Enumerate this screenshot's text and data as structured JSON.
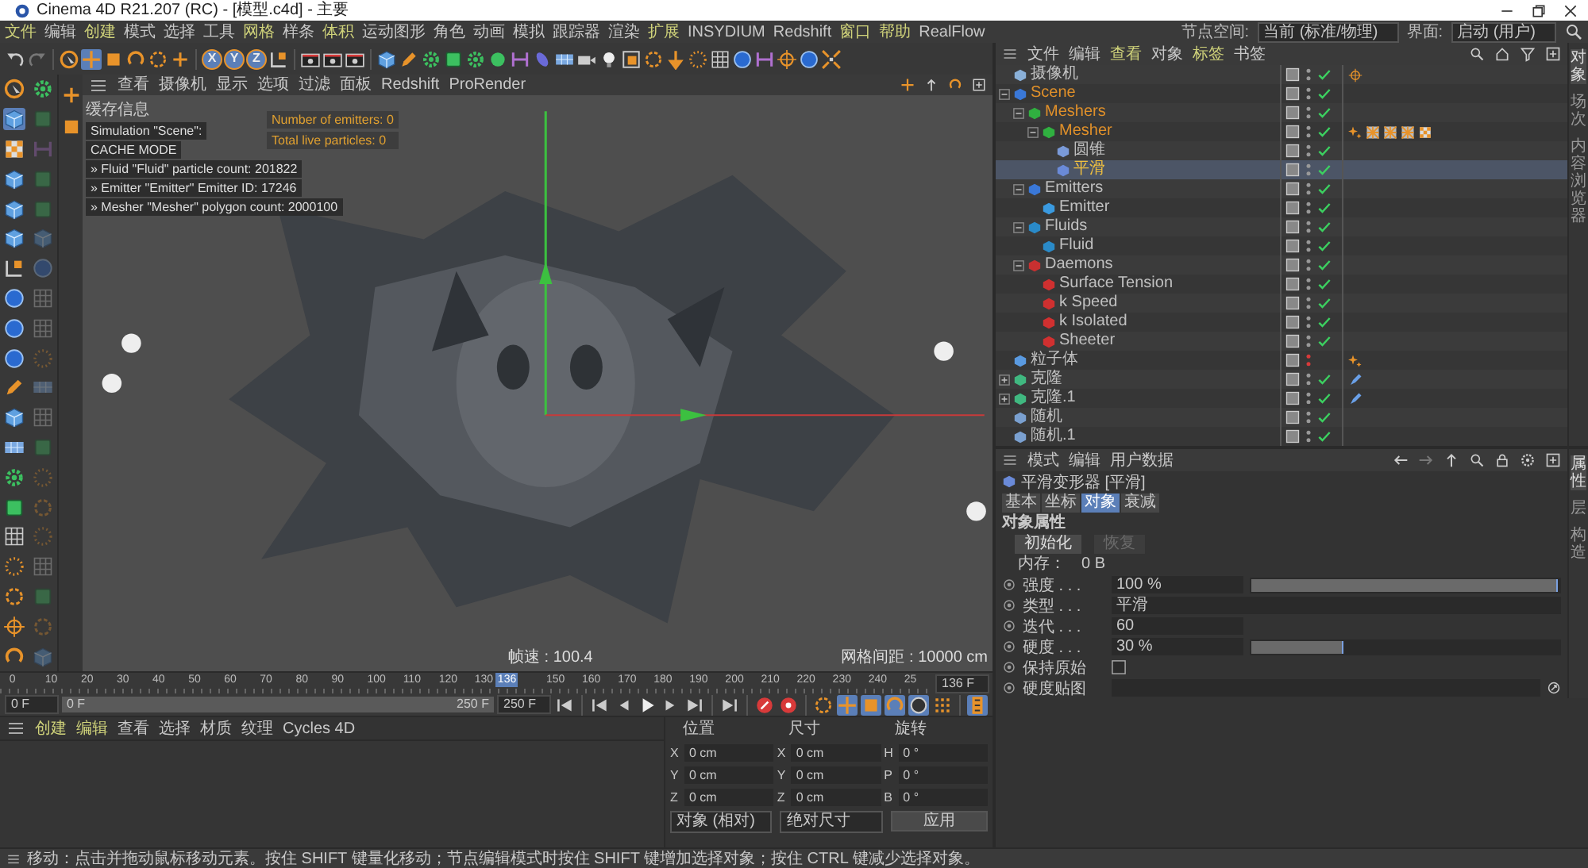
{
  "window": {
    "title": "Cinema 4D R21.207 (RC) - [模型.c4d] - 主要"
  },
  "menu": [
    {
      "label": "文件",
      "highlighted": true
    },
    {
      "label": "编辑",
      "highlighted": false
    },
    {
      "label": "创建",
      "highlighted": true
    },
    {
      "label": "模式",
      "highlighted": false
    },
    {
      "label": "选择",
      "highlighted": false
    },
    {
      "label": "工具",
      "highlighted": false
    },
    {
      "label": "网格",
      "highlighted": true
    },
    {
      "label": "样条",
      "highlighted": false
    },
    {
      "label": "体积",
      "highlighted": true
    },
    {
      "label": "运动图形",
      "highlighted": false
    },
    {
      "label": "角色",
      "highlighted": false
    },
    {
      "label": "动画",
      "highlighted": false
    },
    {
      "label": "模拟",
      "highlighted": false
    },
    {
      "label": "跟踪器",
      "highlighted": false
    },
    {
      "label": "渲染",
      "highlighted": false
    },
    {
      "label": "扩展",
      "highlighted": true
    },
    {
      "label": "INSYDIUM",
      "highlighted": false
    },
    {
      "label": "Redshift",
      "highlighted": false
    },
    {
      "label": "窗口",
      "highlighted": true
    },
    {
      "label": "帮助",
      "highlighted": true
    },
    {
      "label": "RealFlow",
      "highlighted": false
    }
  ],
  "node_space": {
    "label": "节点空间:",
    "value": "当前 (标准/物理)"
  },
  "layout": {
    "label": "界面:",
    "value": "启动 (用户)"
  },
  "toolbar": [
    {
      "kind": "undo",
      "selected": false
    },
    {
      "kind": "redo",
      "selected": false
    },
    {
      "kind": "sep"
    },
    {
      "kind": "select",
      "selected": false
    },
    {
      "kind": "move",
      "selected": true
    },
    {
      "kind": "scale",
      "selected": false
    },
    {
      "kind": "rotate",
      "selected": false
    },
    {
      "kind": "ring",
      "selected": false
    },
    {
      "kind": "plus",
      "selected": false
    },
    {
      "kind": "sep"
    },
    {
      "kind": "axis",
      "label": "X",
      "selected": true
    },
    {
      "kind": "axis",
      "label": "Y",
      "selected": true
    },
    {
      "kind": "axis",
      "label": "Z",
      "selected": true
    },
    {
      "kind": "axes",
      "selected": false
    },
    {
      "kind": "sep"
    },
    {
      "kind": "clap",
      "selected": false
    },
    {
      "kind": "clap",
      "selected": false
    },
    {
      "kind": "clap",
      "selected": false
    },
    {
      "kind": "sep"
    },
    {
      "kind": "cube",
      "selected": false
    },
    {
      "kind": "pen",
      "selected": false
    },
    {
      "kind": "gear",
      "selected": false
    },
    {
      "kind": "box",
      "selected": false
    },
    {
      "kind": "gear",
      "selected": false
    },
    {
      "kind": "sphere",
      "selected": false
    },
    {
      "kind": "bars",
      "selected": false
    },
    {
      "kind": "blob",
      "selected": false
    },
    {
      "kind": "plane",
      "selected": false
    },
    {
      "kind": "camera",
      "selected": false
    },
    {
      "kind": "bulb",
      "selected": false
    },
    {
      "kind": "frame",
      "selected": false
    },
    {
      "kind": "ring",
      "selected": false
    },
    {
      "kind": "arrow",
      "selected": false
    },
    {
      "kind": "dots",
      "selected": false
    },
    {
      "kind": "grid",
      "selected": false
    },
    {
      "kind": "coin",
      "selected": false
    },
    {
      "kind": "bars",
      "selected": false
    },
    {
      "kind": "target",
      "selected": false
    },
    {
      "kind": "coin",
      "selected": false
    },
    {
      "kind": "shrink",
      "selected": false
    }
  ],
  "palette": [
    {
      "kind": "select",
      "selected": false,
      "disabled": false
    },
    {
      "kind": "cube",
      "selected": true,
      "disabled": false
    },
    {
      "kind": "checker",
      "selected": false,
      "disabled": false
    },
    {
      "kind": "cube",
      "selected": false,
      "disabled": false
    },
    {
      "kind": "cube",
      "selected": false,
      "disabled": false
    },
    {
      "kind": "cube",
      "selected": false,
      "disabled": false
    },
    {
      "kind": "axes",
      "selected": false,
      "disabled": false
    },
    {
      "kind": "coin",
      "selected": false,
      "disabled": false
    },
    {
      "kind": "coin",
      "selected": false,
      "disabled": false
    },
    {
      "kind": "coin",
      "selected": false,
      "disabled": false
    },
    {
      "kind": "pen",
      "selected": false,
      "disabled": false
    },
    {
      "kind": "cube",
      "selected": false,
      "disabled": false
    },
    {
      "kind": "plane",
      "selected": false,
      "disabled": false
    },
    {
      "kind": "gear",
      "selected": false,
      "disabled": false
    },
    {
      "kind": "box",
      "selected": false,
      "disabled": false
    },
    {
      "kind": "grid",
      "selected": false,
      "disabled": false
    },
    {
      "kind": "dots",
      "selected": false,
      "disabled": false
    },
    {
      "kind": "ring",
      "selected": false,
      "disabled": false
    },
    {
      "kind": "target",
      "selected": false,
      "disabled": false
    },
    {
      "kind": "rotate",
      "selected": false,
      "disabled": false
    },
    {
      "kind": "gear",
      "selected": false,
      "disabled": false
    },
    {
      "kind": "box",
      "selected": false,
      "disabled": true
    },
    {
      "kind": "bars",
      "selected": false,
      "disabled": true
    },
    {
      "kind": "box",
      "selected": false,
      "disabled": true
    },
    {
      "kind": "box",
      "selected": false,
      "disabled": true
    },
    {
      "kind": "cube",
      "selected": false,
      "disabled": true
    },
    {
      "kind": "coin",
      "selected": false,
      "disabled": true
    },
    {
      "kind": "grid",
      "selected": false,
      "disabled": true
    },
    {
      "kind": "grid",
      "selected": false,
      "disabled": true
    },
    {
      "kind": "dots",
      "selected": false,
      "disabled": true
    },
    {
      "kind": "plane",
      "selected": false,
      "disabled": true
    },
    {
      "kind": "grid",
      "selected": false,
      "disabled": true
    },
    {
      "kind": "box",
      "selected": false,
      "disabled": true
    },
    {
      "kind": "dots",
      "selected": false,
      "disabled": true
    },
    {
      "kind": "ring",
      "selected": false,
      "disabled": true
    },
    {
      "kind": "dots",
      "selected": false,
      "disabled": true
    },
    {
      "kind": "grid",
      "selected": false,
      "disabled": true
    },
    {
      "kind": "box",
      "selected": false,
      "disabled": true
    },
    {
      "kind": "ring",
      "selected": false,
      "disabled": true
    },
    {
      "kind": "cube",
      "selected": false,
      "disabled": true
    }
  ],
  "viewport": {
    "menu": [
      "查看",
      "摄像机",
      "显示",
      "选项",
      "过滤",
      "面板",
      "Redshift",
      "ProRender"
    ],
    "info": {
      "title": "缓存信息",
      "lines": [
        "Simulation \"Scene\":",
        "CACHE MODE",
        "» Fluid \"Fluid\" particle count: 201822",
        "» Emitter \"Emitter\" Emitter ID: 17246",
        "» Mesher \"Mesher\" polygon count: 2000100"
      ]
    },
    "stats": [
      "Number of emitters: 0",
      "Total live particles: 0"
    ],
    "fps": "帧速 : 100.4",
    "grid": "网格间距 : 10000 cm"
  },
  "object_manager": {
    "menu": [
      {
        "label": "文件",
        "highlighted": false
      },
      {
        "label": "编辑",
        "highlighted": false
      },
      {
        "label": "查看",
        "highlighted": true
      },
      {
        "label": "对象",
        "highlighted": false
      },
      {
        "label": "标签",
        "highlighted": true
      },
      {
        "label": "书签",
        "highlighted": false
      }
    ],
    "side_tabs": [
      {
        "label": "对象",
        "selected": true
      },
      {
        "label": "场次",
        "selected": false
      },
      {
        "label": "内容浏览器",
        "selected": false
      }
    ],
    "objects": [
      {
        "name": "摄像机",
        "color": "#8ab0d8",
        "selected": false,
        "highlighted": false,
        "enabled": true,
        "tags": [
          {
            "kind": "target"
          }
        ]
      },
      {
        "name": "Scene",
        "color": "#3a78d8",
        "selected": false,
        "highlighted": true,
        "enabled": true,
        "expanded": true,
        "children": [
          {
            "name": "Meshers",
            "color": "#30b040",
            "selected": false,
            "highlighted": true,
            "enabled": true,
            "expanded": true,
            "children": [
              {
                "name": "Mesher",
                "color": "#30b040",
                "selected": false,
                "highlighted": true,
                "enabled": true,
                "expanded": true,
                "tags": [
                  {
                    "kind": "star"
                  },
                  {
                    "kind": "texture"
                  },
                  {
                    "kind": "texture"
                  },
                  {
                    "kind": "texture"
                  },
                  {
                    "kind": "checker"
                  }
                ],
                "children": [
                  {
                    "name": "圆锥",
                    "color": "#7a9ad8",
                    "selected": false,
                    "highlighted": false,
                    "enabled": true
                  },
                  {
                    "name": "平滑",
                    "color": "#6a8ad8",
                    "selected": true,
                    "highlighted": false,
                    "enabled": true
                  }
                ]
              }
            ]
          },
          {
            "name": "Emitters",
            "color": "#3a78d8",
            "selected": false,
            "highlighted": false,
            "enabled": true,
            "expanded": true,
            "children": [
              {
                "name": "Emitter",
                "color": "#3a9ae0",
                "selected": false,
                "highlighted": false,
                "enabled": true
              }
            ]
          },
          {
            "name": "Fluids",
            "color": "#2a8ac8",
            "selected": false,
            "highlighted": false,
            "enabled": true,
            "expanded": true,
            "children": [
              {
                "name": "Fluid",
                "color": "#2a8ac8",
                "selected": false,
                "highlighted": false,
                "enabled": true
              }
            ]
          },
          {
            "name": "Daemons",
            "color": "#c83030",
            "selected": false,
            "highlighted": false,
            "enabled": true,
            "expanded": true,
            "children": [
              {
                "name": "Surface Tension",
                "color": "#d03030",
                "selected": false,
                "highlighted": false,
                "enabled": true
              },
              {
                "name": "k Speed",
                "color": "#d03030",
                "selected": false,
                "highlighted": false,
                "enabled": true
              },
              {
                "name": "k Isolated",
                "color": "#d03030",
                "selected": false,
                "highlighted": false,
                "enabled": true
              },
              {
                "name": "Sheeter",
                "color": "#d03030",
                "selected": false,
                "highlighted": false,
                "enabled": true
              }
            ]
          }
        ]
      },
      {
        "name": "粒子体",
        "color": "#5a9ae0",
        "selected": false,
        "highlighted": false,
        "enabled": false,
        "tags": [
          {
            "kind": "star"
          }
        ]
      },
      {
        "name": "克隆",
        "color": "#40b880",
        "selected": false,
        "highlighted": false,
        "enabled": true,
        "expanded": false,
        "tags": [
          {
            "kind": "brush"
          }
        ]
      },
      {
        "name": "克隆.1",
        "color": "#40b880",
        "selected": false,
        "highlighted": false,
        "enabled": true,
        "expanded": false,
        "tags": [
          {
            "kind": "brush"
          }
        ]
      },
      {
        "name": "随机",
        "color": "#7aa0d0",
        "selected": false,
        "highlighted": false,
        "enabled": true
      },
      {
        "name": "随机.1",
        "color": "#7aa0d0",
        "selected": false,
        "highlighted": false,
        "enabled": true
      }
    ]
  },
  "attributes": {
    "menu": [
      "模式",
      "编辑",
      "用户数据"
    ],
    "side_tabs": [
      {
        "label": "属性",
        "selected": true
      },
      {
        "label": "层",
        "selected": false
      },
      {
        "label": "构造",
        "selected": false
      }
    ],
    "title": "平滑变形器 [平滑]",
    "tabs": [
      {
        "label": "基本",
        "selected": false
      },
      {
        "label": "坐标",
        "selected": false
      },
      {
        "label": "对象",
        "selected": true
      },
      {
        "label": "衰减",
        "selected": false
      }
    ],
    "section": "对象属性",
    "buttons": [
      {
        "label": "初始化",
        "disabled": false
      },
      {
        "label": "恢复",
        "disabled": true
      }
    ],
    "memory": {
      "label": "内存：",
      "value": "0 B"
    },
    "rows": [
      {
        "kind": "slider",
        "label": "强度 . . .",
        "value": "100 %",
        "level": 1
      },
      {
        "kind": "dropdown",
        "label": "类型 . . .",
        "value": "平滑"
      },
      {
        "kind": "number",
        "label": "迭代 . . .",
        "value": "60"
      },
      {
        "kind": "slider",
        "label": "硬度 . . .",
        "value": "30 %",
        "level": 0.3
      },
      {
        "kind": "checkbox",
        "label": "保持原始",
        "checked": false
      },
      {
        "kind": "link",
        "label": "硬度贴图"
      }
    ]
  },
  "timeline": {
    "ticks": [
      "0",
      "10",
      "20",
      "30",
      "40",
      "50",
      "60",
      "70",
      "80",
      "90",
      "100",
      "110",
      "120",
      "130",
      "150",
      "160",
      "170",
      "180",
      "190",
      "200",
      "210",
      "220",
      "230",
      "240",
      "25"
    ],
    "playhead": {
      "label": "136",
      "level": 0.544
    },
    "current": "136 F",
    "start": "0 F",
    "range_start": "0 F",
    "range_end": "250 F",
    "end": "250 F",
    "transport": [
      {
        "kind": "first",
        "selected": false
      },
      {
        "kind": "sep"
      },
      {
        "kind": "first",
        "selected": false
      },
      {
        "kind": "prev",
        "selected": false
      },
      {
        "kind": "play",
        "selected": false
      },
      {
        "kind": "next",
        "selected": false
      },
      {
        "kind": "last",
        "selected": false
      },
      {
        "kind": "sep"
      },
      {
        "kind": "last",
        "selected": false
      },
      {
        "kind": "sep"
      },
      {
        "kind": "rec",
        "selected": false
      },
      {
        "kind": "key",
        "selected": false
      },
      {
        "kind": "sep"
      },
      {
        "kind": "ring",
        "selected": false
      },
      {
        "kind": "move",
        "selected": true
      },
      {
        "kind": "scale",
        "selected": true
      },
      {
        "kind": "rotate",
        "selected": true
      },
      {
        "kind": "pcircle",
        "selected": true
      },
      {
        "kind": "dotgrid",
        "selected": false
      },
      {
        "kind": "sep"
      },
      {
        "kind": "film",
        "selected": true
      }
    ]
  },
  "materials": {
    "menu": [
      {
        "label": "创建",
        "highlighted": true
      },
      {
        "label": "编辑",
        "highlighted": true
      },
      {
        "label": "查看",
        "highlighted": false
      },
      {
        "label": "选择",
        "highlighted": false
      },
      {
        "label": "材质",
        "highlighted": false
      },
      {
        "label": "纹理",
        "highlighted": false
      },
      {
        "label": "Cycles 4D",
        "highlighted": false
      }
    ]
  },
  "coordinates": {
    "headers": [
      "位置",
      "尺寸",
      "旋转"
    ],
    "rows": [
      {
        "axis": "X",
        "position": "0 cm",
        "size_axis": "X",
        "size": "0 cm",
        "rotation_axis": "H",
        "rotation": "0 °"
      },
      {
        "axis": "Y",
        "position": "0 cm",
        "size_axis": "Y",
        "size": "0 cm",
        "rotation_axis": "P",
        "rotation": "0 °"
      },
      {
        "axis": "Z",
        "position": "0 cm",
        "size_axis": "Z",
        "size": "0 cm",
        "rotation_axis": "B",
        "rotation": "0 °"
      }
    ],
    "mode": "对象 (相对)",
    "size_mode": "绝对尺寸",
    "apply": "应用"
  },
  "status_bar": "移动：点击并拖动鼠标移动元素。按住 SHIFT 键量化移动；节点编辑模式时按住 SHIFT 键增加选择对象；按住 CTRL 键减少选择对象。"
}
